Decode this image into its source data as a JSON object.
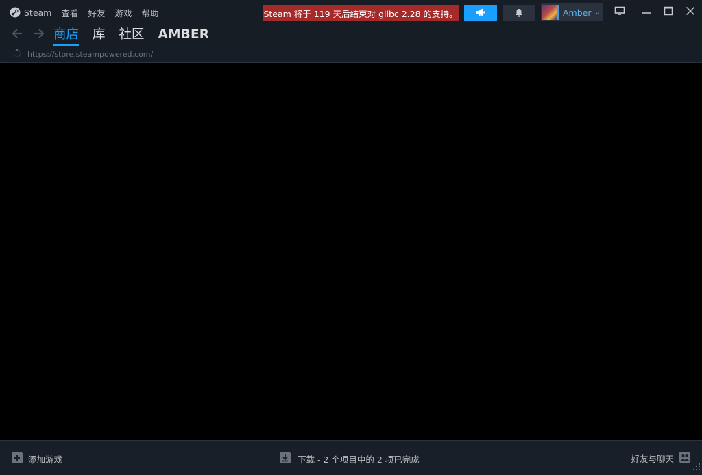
{
  "menu": {
    "steam": "Steam",
    "view": "查看",
    "friends": "好友",
    "games": "游戏",
    "help": "帮助"
  },
  "notice": "Steam 将于 119 天后结束对 glibc 2.28 的支持。",
  "account": {
    "name": "Amber"
  },
  "nav": {
    "tabs": [
      "商店",
      "库",
      "社区",
      "AMBER"
    ],
    "active_tab": "商店"
  },
  "url": "https://store.steampowered.com/",
  "footer": {
    "add_game": "添加游戏",
    "downloads": "下载 - 2 个项目中的 2 项已完成",
    "friends_chat": "好友与聊天"
  },
  "colors": {
    "accent": "#1a9fff",
    "notice_bg": "#a52a2a",
    "background": "#171d25"
  },
  "icons": {
    "steam": "steam-logo-icon",
    "announce": "megaphone-icon",
    "bell": "bell-icon",
    "monitor": "monitor-icon",
    "minimize": "minimize-icon",
    "maximize": "maximize-icon",
    "close": "close-icon",
    "back": "arrow-left-icon",
    "forward": "arrow-right-icon",
    "loading": "loading-spinner-icon",
    "add": "plus-icon",
    "download": "download-icon",
    "friends": "friends-icon"
  }
}
